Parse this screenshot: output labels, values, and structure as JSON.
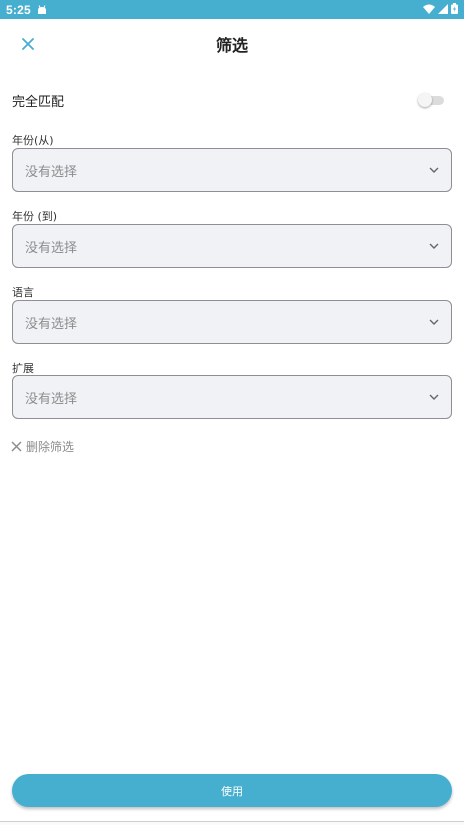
{
  "status_bar": {
    "time": "5:25",
    "icons": [
      "android-icon",
      "wifi-icon",
      "signal-icon",
      "battery-icon"
    ]
  },
  "header": {
    "title": "筛选",
    "close_icon": "close-icon"
  },
  "exact_match": {
    "label": "完全匹配",
    "enabled": false
  },
  "fields": [
    {
      "label": "年份(从)",
      "value": "没有选择"
    },
    {
      "label": "年份 (到)",
      "value": "没有选择"
    },
    {
      "label": "语言",
      "value": "没有选择"
    },
    {
      "label": "扩展",
      "value": "没有选择"
    }
  ],
  "remove_filter": {
    "label": "删除筛选"
  },
  "apply_button": {
    "label": "使用"
  },
  "colors": {
    "accent": "#46aecf",
    "field_background": "#f1f2f6",
    "placeholder_text": "#8d8d8d"
  }
}
